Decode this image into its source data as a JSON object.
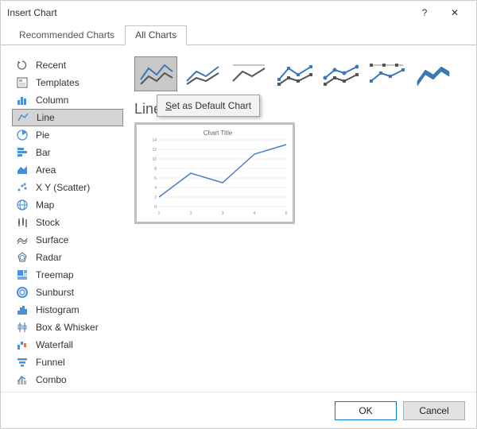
{
  "window": {
    "title": "Insert Chart",
    "help": "?",
    "close": "✕"
  },
  "tabs": {
    "recommended": "Recommended Charts",
    "all": "All Charts"
  },
  "sidebar": {
    "items": [
      {
        "label": "Recent"
      },
      {
        "label": "Templates"
      },
      {
        "label": "Column"
      },
      {
        "label": "Line"
      },
      {
        "label": "Pie"
      },
      {
        "label": "Bar"
      },
      {
        "label": "Area"
      },
      {
        "label": "X Y (Scatter)"
      },
      {
        "label": "Map"
      },
      {
        "label": "Stock"
      },
      {
        "label": "Surface"
      },
      {
        "label": "Radar"
      },
      {
        "label": "Treemap"
      },
      {
        "label": "Sunburst"
      },
      {
        "label": "Histogram"
      },
      {
        "label": "Box & Whisker"
      },
      {
        "label": "Waterfall"
      },
      {
        "label": "Funnel"
      },
      {
        "label": "Combo"
      }
    ],
    "selected_index": 3
  },
  "context_menu": {
    "label_prefix": "S",
    "label_rest": "et as Default Chart"
  },
  "main": {
    "chart_name": "Line",
    "preview_title": "Chart Title"
  },
  "chart_data": {
    "type": "line",
    "categories": [
      "1",
      "2",
      "3",
      "4",
      "5"
    ],
    "values": [
      2,
      7,
      5,
      11,
      13
    ],
    "title": "Chart Title",
    "xlabel": "",
    "ylabel": "",
    "ylim": [
      0,
      14
    ],
    "yticks": [
      0,
      2,
      4,
      6,
      8,
      10,
      12,
      14
    ]
  },
  "footer": {
    "ok": "OK",
    "cancel": "Cancel"
  }
}
